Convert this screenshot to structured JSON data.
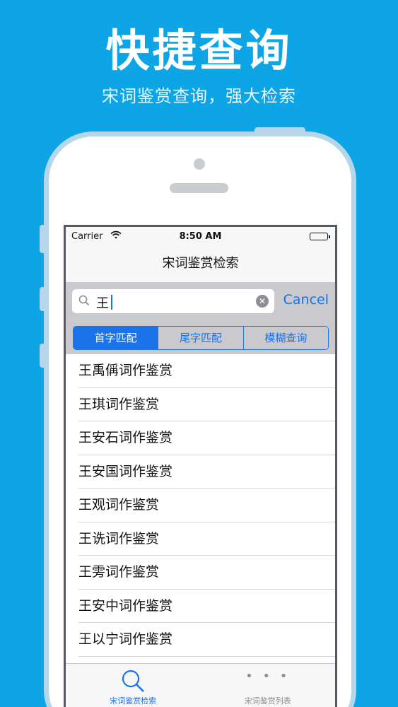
{
  "promo": {
    "headline": "快捷查询",
    "subline": "宋词鉴赏查询，强大检索"
  },
  "status_bar": {
    "carrier": "Carrier",
    "time": "8:50 AM"
  },
  "nav": {
    "title": "宋词鉴赏检索"
  },
  "search": {
    "value": "王",
    "cancel_label": "Cancel"
  },
  "segments": {
    "items": [
      {
        "label": "首字匹配",
        "selected": true
      },
      {
        "label": "尾字匹配",
        "selected": false
      },
      {
        "label": "模糊查询",
        "selected": false
      }
    ]
  },
  "results": {
    "items": [
      "王禹偁词作鉴赏",
      "王琪词作鉴赏",
      "王安石词作鉴赏",
      "王安国词作鉴赏",
      "王观词作鉴赏",
      "王诜词作鉴赏",
      "王雱词作鉴赏",
      "王安中词作鉴赏",
      "王以宁词作鉴赏"
    ]
  },
  "tab_bar": {
    "tabs": [
      {
        "label": "宋词鉴赏检索",
        "icon": "search-icon",
        "active": true
      },
      {
        "label": "宋词鉴赏列表",
        "icon": "more-icon",
        "active": false
      }
    ]
  },
  "colors": {
    "background": "#0ea5e6",
    "accent": "#1a73e8",
    "phone_frame": "#b6d7ea"
  }
}
